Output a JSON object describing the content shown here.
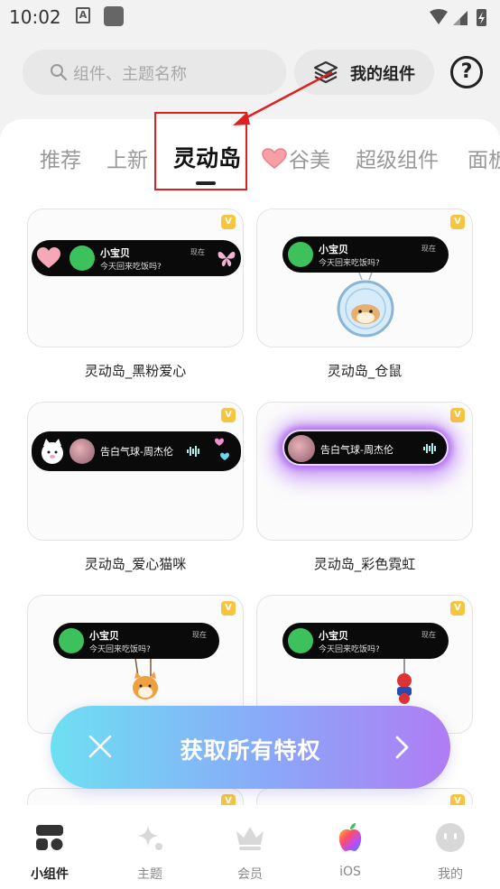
{
  "status_bar": {
    "time": "10:02",
    "a_label": "A"
  },
  "search": {
    "placeholder": "组件、主题名称"
  },
  "header": {
    "my_widgets_label": "我的组件",
    "help_label": "?"
  },
  "tabs": [
    {
      "label": "推荐"
    },
    {
      "label": "上新"
    },
    {
      "label": "灵动岛",
      "active": true
    },
    {
      "label": "谷美",
      "icon": "heart-icon"
    },
    {
      "label": "超级组件"
    },
    {
      "label": "面板"
    }
  ],
  "cards": [
    {
      "title": "灵动岛_黑粉爱心",
      "island": {
        "name": "小宝贝",
        "message": "今天回来吃饭吗?",
        "time": "现在"
      }
    },
    {
      "title": "灵动岛_仓鼠",
      "island": {
        "name": "小宝贝",
        "message": "今天回来吃饭吗?",
        "time": "现在"
      }
    },
    {
      "title": "灵动岛_爱心猫咪",
      "island": {
        "song": "告白气球-周杰伦"
      }
    },
    {
      "title": "灵动岛_彩色霓虹",
      "island": {
        "song": "告白气球-周杰伦"
      }
    },
    {
      "title": "",
      "island": {
        "name": "小宝贝",
        "message": "今天回来吃饭吗?",
        "time": "现在"
      }
    },
    {
      "title": "",
      "island": {
        "name": "小宝贝",
        "message": "今天回来吃饭吗?",
        "time": "现在"
      }
    }
  ],
  "badge": {
    "label": "V",
    "color": "#f5c542"
  },
  "cta": {
    "label": "获取所有特权"
  },
  "bottom_nav": [
    {
      "label": "小组件",
      "icon": "widgets-icon",
      "active": true
    },
    {
      "label": "主题",
      "icon": "sparkle-icon"
    },
    {
      "label": "会员",
      "icon": "crown-icon"
    },
    {
      "label": "iOS",
      "icon": "apple-icon"
    },
    {
      "label": "我的",
      "icon": "profile-icon"
    }
  ],
  "colors": {
    "accent_red": "#e02020",
    "wechat_green": "#3cc15c",
    "cta_start": "#6ee0f2",
    "cta_end": "#b07cf4"
  }
}
